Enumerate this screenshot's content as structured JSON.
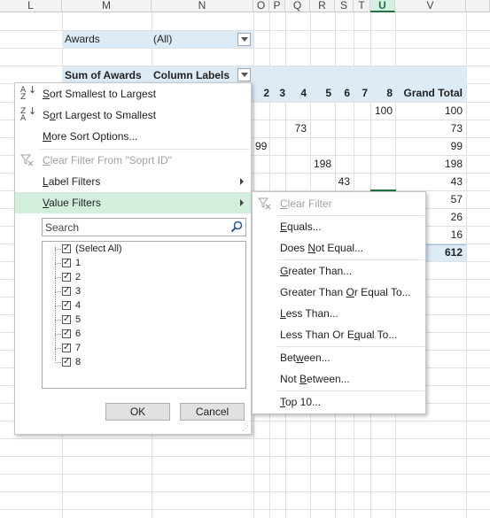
{
  "sheet": {
    "columns": [
      "L",
      "M",
      "N",
      "O",
      "P",
      "Q",
      "R",
      "S",
      "T",
      "U",
      "V"
    ],
    "selected_column": "U",
    "awards_label": "Awards",
    "awards_value": "(All)",
    "sum_label": "Sum of Awards",
    "col_labels": "Column Labels",
    "header_cols": [
      "2",
      "3",
      "4",
      "5",
      "6",
      "7",
      "8"
    ],
    "grand_total_label": "Grand Total",
    "body_values": {
      "u_row1": "100",
      "q_row2": "73",
      "o_row3": "99",
      "s_row4": "198",
      "t_row5": "43"
    },
    "grand_totals": [
      "100",
      "73",
      "99",
      "198",
      "43",
      "57",
      "26",
      "16",
      "612"
    ]
  },
  "filter_menu": {
    "items": [
      {
        "label": "Sort Smallest to Largest",
        "underline": "S",
        "rest": "ort Smallest to Largest",
        "disabled": false,
        "icon": "sort-ascending-icon"
      },
      {
        "label": "Sort Largest to Smallest",
        "underline": "",
        "pre": "S",
        "ul": "o",
        "post": "rt Largest to Smallest",
        "disabled": false,
        "icon": "sort-descending-icon"
      },
      {
        "label": "More Sort Options...",
        "pre": "",
        "ul": "M",
        "post": "ore Sort Options...",
        "disabled": false
      },
      {
        "label": "Clear Filter From \"Soprt ID\"",
        "pre": "",
        "ul": "C",
        "post": "lear Filter From \"Soprt ID\"",
        "disabled": true,
        "icon": "clear-filter-icon"
      },
      {
        "label": "Label Filters",
        "pre": "",
        "ul": "L",
        "post": "abel Filters",
        "disabled": false
      },
      {
        "label": "Value Filters",
        "pre": "",
        "ul": "V",
        "post": "alue Filters",
        "disabled": false
      }
    ],
    "search_placeholder": "Search",
    "checklist": [
      "(Select All)",
      "1",
      "2",
      "3",
      "4",
      "5",
      "6",
      "7",
      "8"
    ],
    "ok_label": "OK",
    "cancel_label": "Cancel"
  },
  "value_filters_menu": {
    "items": [
      {
        "pre": "",
        "ul": "C",
        "post": "lear Filter",
        "disabled": true,
        "icon": "clear-filter-icon"
      },
      {
        "pre": "",
        "ul": "E",
        "post": "quals...",
        "disabled": false
      },
      {
        "pre": "Does ",
        "ul": "N",
        "post": "ot Equal...",
        "disabled": false
      },
      {
        "pre": "",
        "ul": "G",
        "post": "reater Than...",
        "disabled": false
      },
      {
        "pre": "Greater Than ",
        "ul": "O",
        "post": "r Equal To...",
        "disabled": false
      },
      {
        "pre": "",
        "ul": "L",
        "post": "ess Than...",
        "disabled": false
      },
      {
        "pre": "Less Than Or E",
        "ul": "q",
        "post": "ual To...",
        "disabled": false
      },
      {
        "pre": "Bet",
        "ul": "w",
        "post": "een...",
        "disabled": false
      },
      {
        "pre": "Not ",
        "ul": "B",
        "post": "etween...",
        "disabled": false
      },
      {
        "pre": "",
        "ul": "T",
        "post": "op 10...",
        "disabled": false
      }
    ]
  }
}
